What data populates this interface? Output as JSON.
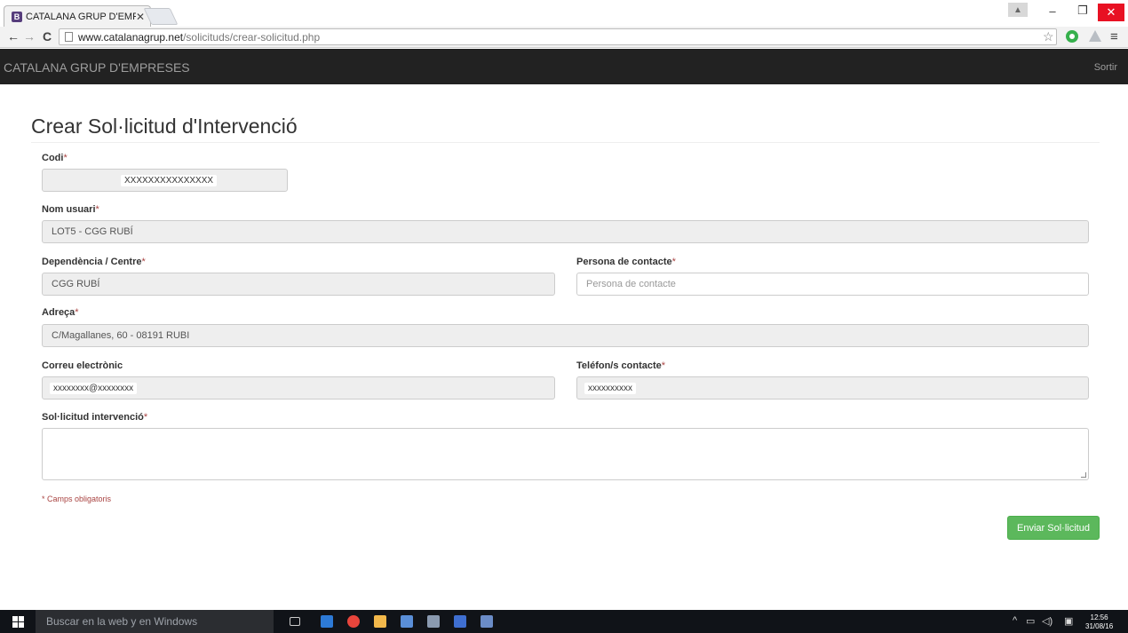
{
  "browser": {
    "tab_title": "CATALANA GRUP D'EMPR",
    "tab_favicon": "B",
    "url_host": "www.catalanagrup.net",
    "url_path": "/solicituds/crear-solicitud.php"
  },
  "navbar": {
    "brand": "CATALANA GRUP D'EMPRESES",
    "logout": "Sortir"
  },
  "page": {
    "title": "Crear Sol·licitud d'Intervenció"
  },
  "form": {
    "codi": {
      "label": "Codi",
      "value": "XXXXXXXXXXXXXXX"
    },
    "nom_usuari": {
      "label": "Nom usuari",
      "value": "LOT5 - CGG RUBÍ"
    },
    "dependencia": {
      "label": "Dependència / Centre",
      "value": "CGG RUBÍ"
    },
    "persona_contacte": {
      "label": "Persona de contacte",
      "placeholder": "Persona de contacte"
    },
    "adreca": {
      "label": "Adreça",
      "value": "C/Magallanes, 60 - 08191 RUBI"
    },
    "correu": {
      "label": "Correu electrònic",
      "value": "xxxxxxxx@xxxxxxxx"
    },
    "telefon": {
      "label": "Teléfon/s contacte",
      "value": "xxxxxxxxxx"
    },
    "solicitud": {
      "label": "Sol·licitud intervenció"
    },
    "required_mark": "*",
    "required_note": "* Camps obligatoris",
    "submit_label": "Enviar Sol·licitud"
  },
  "taskbar": {
    "search_placeholder": "Buscar en la web y en Windows",
    "time": "12:56",
    "date": "31/08/16"
  },
  "colors": {
    "navbar_bg": "#222222",
    "submit_green": "#5cb85c",
    "required_red": "#a94442"
  }
}
